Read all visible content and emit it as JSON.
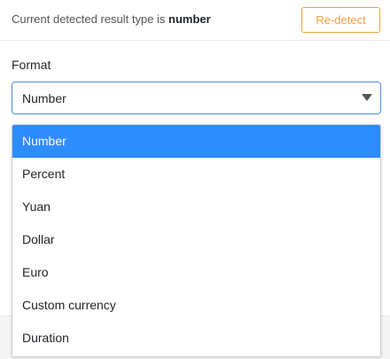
{
  "header": {
    "detected_prefix": "Current detected result type is ",
    "detected_type": "number",
    "redetect_label": "Re-detect",
    "accent_color": "#f09f3f"
  },
  "format": {
    "label": "Format",
    "selected_value": "Number",
    "options": [
      {
        "label": "Number",
        "selected": true
      },
      {
        "label": "Percent",
        "selected": false
      },
      {
        "label": "Yuan",
        "selected": false
      },
      {
        "label": "Dollar",
        "selected": false
      },
      {
        "label": "Euro",
        "selected": false
      },
      {
        "label": "Custom currency",
        "selected": false
      },
      {
        "label": "Duration",
        "selected": false
      }
    ],
    "highlight_color": "#2d8cff",
    "focus_border_color": "#4a90d9"
  }
}
